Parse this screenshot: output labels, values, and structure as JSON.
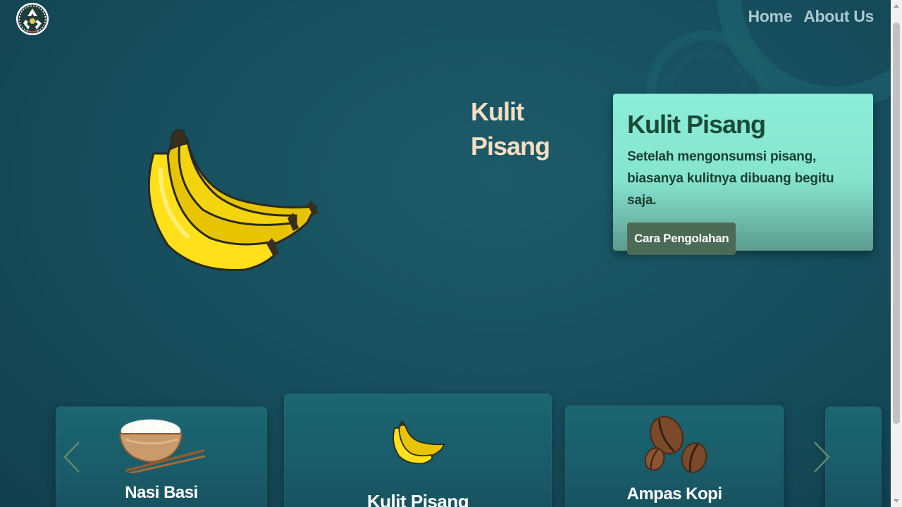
{
  "nav": {
    "home": "Home",
    "about": "About Us"
  },
  "logo": {
    "icon": "recycle-logo-icon"
  },
  "hero": {
    "title": "Kulit Pisang"
  },
  "info_card": {
    "title": "Kulit Pisang",
    "description": "Setelah mengonsumsi pisang, biasanya kulitnya dibuang begitu saja.",
    "button_label": "Cara Pengolahan"
  },
  "carousel": {
    "items": [
      {
        "label": "Nasi Basi",
        "icon": "rice-bowl-icon"
      },
      {
        "label": "Kulit Pisang",
        "icon": "banana-icon"
      },
      {
        "label": "Ampas Kopi",
        "icon": "coffee-beans-icon"
      }
    ]
  },
  "colors": {
    "accent_card": "#8ceed7",
    "button": "#4b6b57",
    "title": "#f6dfc0",
    "background": "#17505f"
  }
}
